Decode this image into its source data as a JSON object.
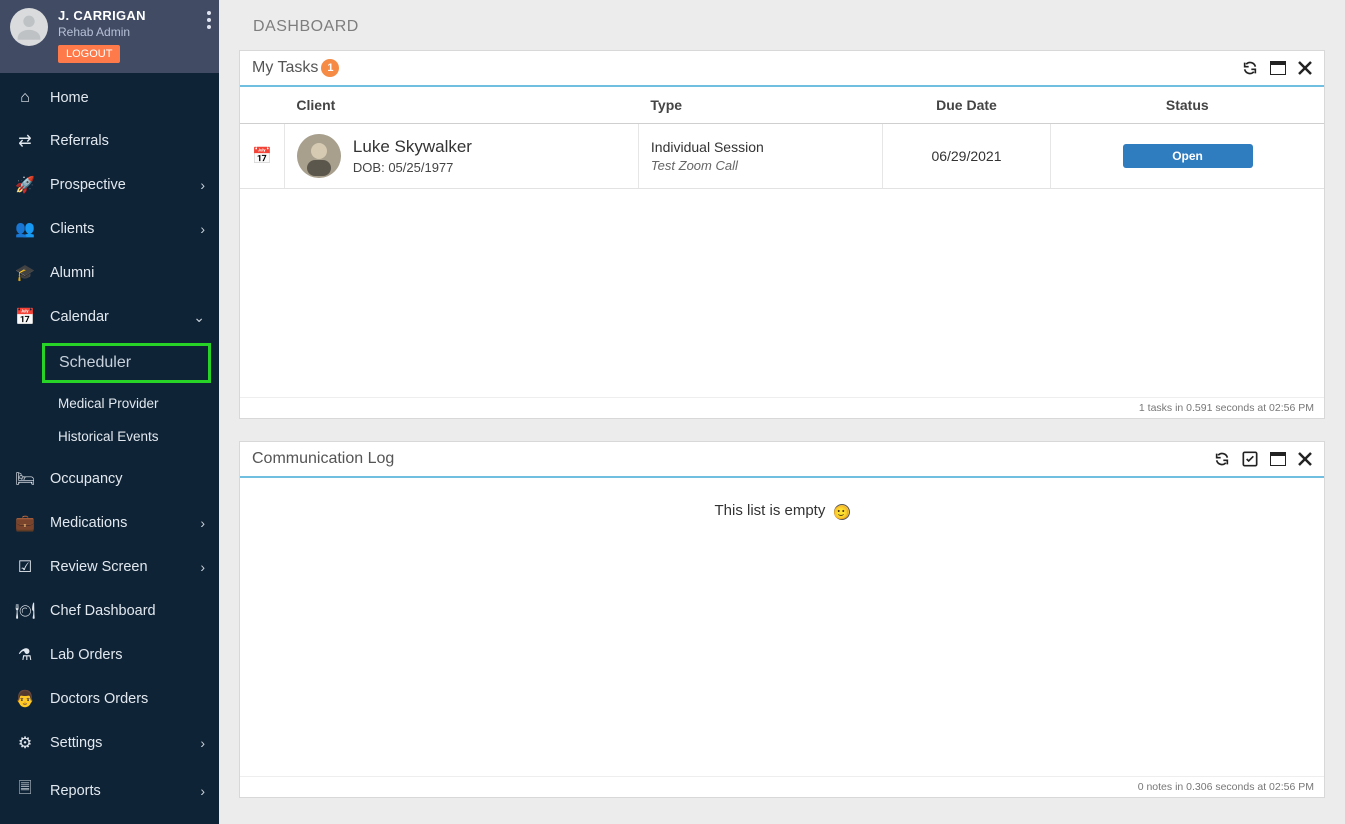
{
  "user": {
    "name": "J. CARRIGAN",
    "role": "Rehab Admin",
    "logout": "LOGOUT"
  },
  "nav": {
    "home": "Home",
    "referrals": "Referrals",
    "prospective": "Prospective",
    "clients": "Clients",
    "alumni": "Alumni",
    "calendar": "Calendar",
    "scheduler": "Scheduler",
    "medprov": "Medical Provider",
    "hist": "Historical Events",
    "occupancy": "Occupancy",
    "medications": "Medications",
    "review": "Review Screen",
    "chef": "Chef Dashboard",
    "lab": "Lab Orders",
    "doctors": "Doctors Orders",
    "settings": "Settings",
    "reports": "Reports"
  },
  "page": {
    "title": "DASHBOARD"
  },
  "tasks": {
    "title": "My Tasks",
    "count": "1",
    "cols": {
      "client": "Client",
      "type": "Type",
      "due": "Due Date",
      "status": "Status"
    },
    "row": {
      "name": "Luke Skywalker",
      "dob": "DOB: 05/25/1977",
      "type1": "Individual Session",
      "type2": "Test Zoom Call",
      "due": "06/29/2021",
      "open": "Open"
    },
    "footer": "1 tasks in 0.591 seconds at 02:56 PM"
  },
  "commlog": {
    "title": "Communication Log",
    "empty": "This list is empty",
    "footer": "0 notes in 0.306 seconds at 02:56 PM"
  }
}
